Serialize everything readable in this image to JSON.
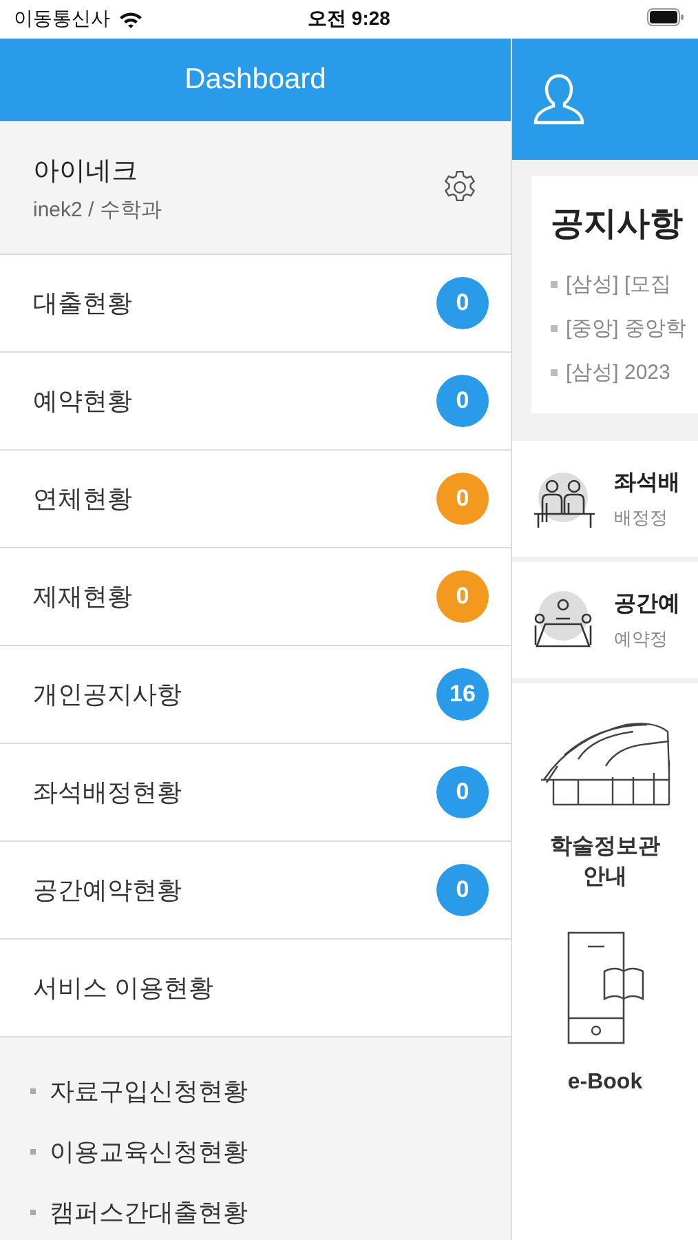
{
  "status_bar": {
    "carrier": "이동통신사",
    "time": "오전 9:28"
  },
  "drawer": {
    "title": "Dashboard",
    "user": {
      "name": "아이네크",
      "detail": "inek2 / 수학과"
    },
    "items": [
      {
        "label": "대출현황",
        "count": "0",
        "color": "#2a9be8"
      },
      {
        "label": "예약현황",
        "count": "0",
        "color": "#2a9be8"
      },
      {
        "label": "연체현황",
        "count": "0",
        "color": "#f39a1e"
      },
      {
        "label": "제재현황",
        "count": "0",
        "color": "#f39a1e"
      },
      {
        "label": "개인공지사항",
        "count": "16",
        "color": "#2a9be8"
      },
      {
        "label": "좌석배정현황",
        "count": "0",
        "color": "#2a9be8"
      },
      {
        "label": "공간예약현황",
        "count": "0",
        "color": "#2a9be8"
      },
      {
        "label": "서비스 이용현황"
      }
    ],
    "sub_items": [
      "자료구입신청현황",
      "이용교육신청현황",
      "캠퍼스간대출현황"
    ]
  },
  "main": {
    "notice": {
      "title": "공지사항",
      "items": [
        "[삼성] [모집",
        "[중앙] 중앙학",
        "[삼성] 2023"
      ]
    },
    "services": [
      {
        "kind": "seat",
        "title": "좌석배",
        "subtitle": "배정정"
      },
      {
        "kind": "room",
        "title": "공간예",
        "subtitle": "예약정"
      }
    ],
    "tiles": [
      {
        "kind": "building",
        "label": "학술정보관\n안내"
      },
      {
        "kind": "ebook",
        "label": "e-Book"
      }
    ]
  }
}
